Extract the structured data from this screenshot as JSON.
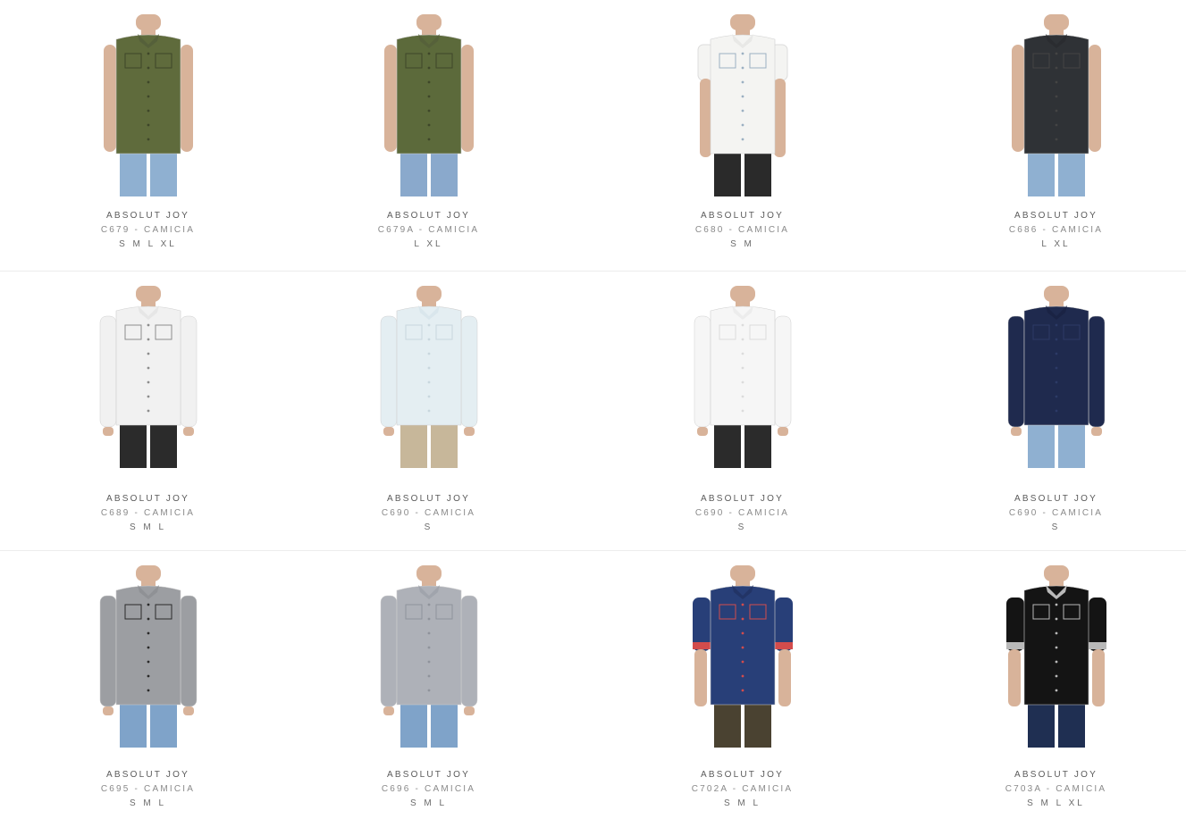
{
  "products": [
    {
      "brand": "ABSOLUT JOY",
      "model": "C679 - CAMICIA",
      "sizes": "S M L XL",
      "shirt": "#5f6b3c",
      "collar": "#55603a",
      "sleeve": "none",
      "pants": "#8fb0d1",
      "accent": "#3e4629"
    },
    {
      "brand": "ABSOLUT JOY",
      "model": "C679A - CAMICIA",
      "sizes": "L XL",
      "shirt": "#5c6a3b",
      "collar": "#56613a",
      "sleeve": "none",
      "pants": "#8aa9cc",
      "accent": "#3e4629"
    },
    {
      "brand": "ABSOLUT JOY",
      "model": "C680 - CAMICIA",
      "sizes": "S M",
      "shirt": "#f4f4f2",
      "collar": "#e8e8e6",
      "sleeve": "short",
      "pants": "#2a2a2a",
      "accent": "#9bb0c2"
    },
    {
      "brand": "ABSOLUT JOY",
      "model": "C686 - CAMICIA",
      "sizes": "L XL",
      "shirt": "#2f3236",
      "collar": "#2a2c30",
      "sleeve": "none",
      "pants": "#8fb0d1",
      "accent": "#444"
    },
    {
      "brand": "ABSOLUT JOY",
      "model": "C689 - CAMICIA",
      "sizes": "S M L",
      "shirt": "#f1f1f1",
      "collar": "#e6e6e6",
      "sleeve": "long",
      "pants": "#2b2b2b",
      "accent": "#8d8d8d"
    },
    {
      "brand": "ABSOLUT JOY",
      "model": "C690 - CAMICIA",
      "sizes": "S",
      "shirt": "#e4eef2",
      "collar": "#d9e6ec",
      "sleeve": "long",
      "pants": "#c7b79a",
      "accent": "#c9d7de"
    },
    {
      "brand": "ABSOLUT JOY",
      "model": "C690 - CAMICIA",
      "sizes": "S",
      "shirt": "#f6f6f6",
      "collar": "#ececec",
      "sleeve": "long",
      "pants": "#2b2b2b",
      "accent": "#dcdcdc"
    },
    {
      "brand": "ABSOLUT JOY",
      "model": "C690 - CAMICIA",
      "sizes": "S",
      "shirt": "#1f2a4e",
      "collar": "#1a2344",
      "sleeve": "long",
      "pants": "#8fb0d1",
      "accent": "#2c3a66"
    },
    {
      "brand": "ABSOLUT JOY",
      "model": "C695 - CAMICIA",
      "sizes": "S M L",
      "shirt": "#9c9ea2",
      "collar": "#8f9195",
      "sleeve": "long",
      "pants": "#7fa3c9",
      "accent": "#2a2a2a"
    },
    {
      "brand": "ABSOLUT JOY",
      "model": "C696 - CAMICIA",
      "sizes": "S M L",
      "shirt": "#aeb1b8",
      "collar": "#a0a4ac",
      "sleeve": "long",
      "pants": "#7fa3c9",
      "accent": "#8f939b"
    },
    {
      "brand": "ABSOLUT JOY",
      "model": "C702A - CAMICIA",
      "sizes": "S M L",
      "shirt": "#283f78",
      "collar": "#223466",
      "sleeve": "rolled",
      "pants": "#4a4231",
      "accent": "#d34c4c"
    },
    {
      "brand": "ABSOLUT JOY",
      "model": "C703A - CAMICIA",
      "sizes": "S M L XL",
      "shirt": "#141414",
      "collar": "#b9b9b9",
      "sleeve": "rolled",
      "pants": "#1f2f52",
      "accent": "#b9b9b9"
    }
  ]
}
